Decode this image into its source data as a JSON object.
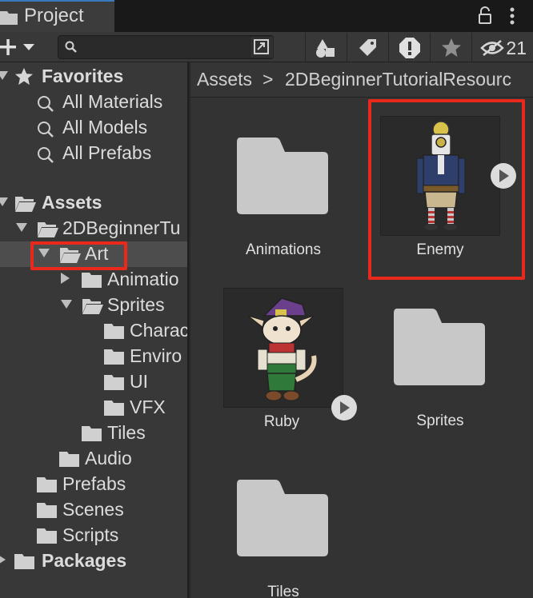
{
  "window": {
    "tab_label": "Project",
    "hidden_count": "21"
  },
  "tree": {
    "favorites": {
      "label": "Favorites",
      "items": [
        "All Materials",
        "All Models",
        "All Prefabs"
      ]
    },
    "assets_label": "Assets",
    "beginner_label": "2DBeginnerTu",
    "art_label": "Art",
    "animations_label": "Animatio",
    "sprites_label": "Sprites",
    "characters_label": "Charac",
    "environment_label": "Enviro",
    "ui_label": "UI",
    "vfx_label": "VFX",
    "tiles_label": "Tiles",
    "audio_label": "Audio",
    "prefabs_label": "Prefabs",
    "scenes_label": "Scenes",
    "scripts_label": "Scripts",
    "packages_label": "Packages"
  },
  "breadcrumb": {
    "root": "Assets",
    "separator": ">",
    "child": "2DBeginnerTutorialResourc"
  },
  "grid": {
    "animations": "Animations",
    "enemy": "Enemy",
    "ruby": "Ruby",
    "sprites": "Sprites",
    "tiles": "Tiles"
  },
  "colors": {
    "highlight": "#e8291c",
    "folder": "#c8c8c8",
    "tab_accent": "#3a79bb"
  }
}
